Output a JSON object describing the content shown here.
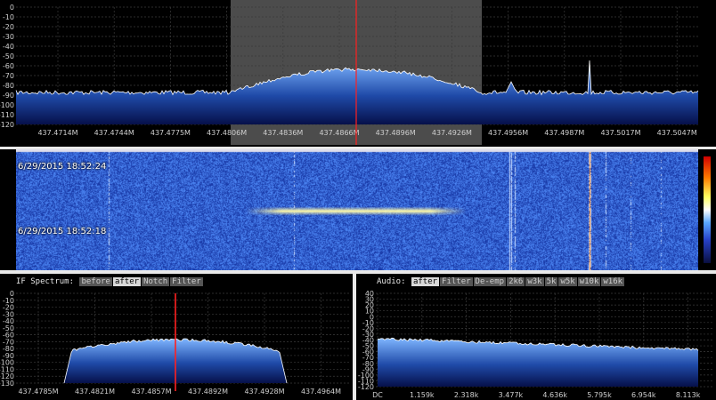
{
  "colors": {
    "signal_fill_top": "#7fb6ff",
    "signal_fill_bottom": "#06104a",
    "center_marker": "#ff2020",
    "passband_highlight": "#8a8a8a",
    "waterfall_bg": "#1c2f9a"
  },
  "main_spectrum": {
    "y_ticks": [
      "0",
      "-10",
      "-20",
      "-30",
      "-40",
      "-50",
      "-60",
      "-70",
      "-80",
      "-90",
      "-100",
      "-110",
      "-120"
    ],
    "x_ticks": [
      "437.4714M",
      "437.4744M",
      "437.4775M",
      "437.4806M",
      "437.4836M",
      "437.4866M",
      "437.4896M",
      "437.4926M",
      "437.4956M",
      "437.4987M",
      "437.5017M",
      "437.5047M"
    ]
  },
  "waterfall": {
    "timestamps": [
      "6/29/2015 18:52:24",
      "6/29/2015 18:52:18"
    ]
  },
  "if_spectrum": {
    "title": "IF Spectrum:",
    "options": [
      {
        "label": "before",
        "active": false
      },
      {
        "label": "after",
        "active": true
      },
      {
        "label": "Notch",
        "active": false
      },
      {
        "label": "Filter",
        "active": false
      }
    ],
    "y_ticks": [
      "0",
      "-10",
      "-20",
      "-30",
      "-40",
      "-50",
      "-60",
      "-70",
      "-80",
      "-90",
      "-100",
      "-110",
      "-120",
      "-130"
    ],
    "x_ticks": [
      "437.4785M",
      "437.4821M",
      "437.4857M",
      "437.4892M",
      "437.4928M",
      "437.4964M"
    ]
  },
  "audio": {
    "title": "Audio:",
    "options": [
      {
        "label": "after",
        "active": true
      },
      {
        "label": "Filter",
        "active": false
      },
      {
        "label": "De-emp",
        "active": false
      },
      {
        "label": "2k6",
        "active": false
      },
      {
        "label": "w3k",
        "active": false
      },
      {
        "label": "5k",
        "active": false
      },
      {
        "label": "w5k",
        "active": false
      },
      {
        "label": "w10k",
        "active": false
      },
      {
        "label": "w16k",
        "active": false
      }
    ],
    "y_ticks": [
      "40",
      "30",
      "20",
      "10",
      "0",
      "-10",
      "-20",
      "-30",
      "-40",
      "-50",
      "-60",
      "-70",
      "-80",
      "-90",
      "-100",
      "-110",
      "-120"
    ],
    "x_ticks": [
      "DC",
      "1.159k",
      "2.318k",
      "3.477k",
      "4.636k",
      "5.795k",
      "6.954k",
      "8.113k"
    ]
  }
}
